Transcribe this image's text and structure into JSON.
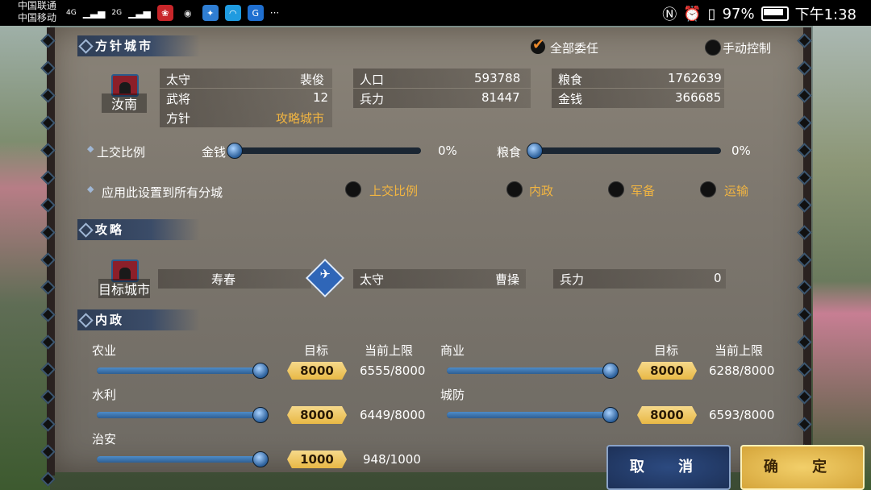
{
  "status_bar": {
    "carrier1": "中国联通",
    "carrier2": "中国移动",
    "signal1": "4G",
    "signal2": "2G",
    "battery": "97%",
    "time": "下午1:38"
  },
  "city_policy": {
    "header": "方针城市",
    "delegate_all": "全部委任",
    "manual_control": "手动控制",
    "city_name": "汝南",
    "stats": {
      "governor_label": "太守",
      "governor_value": "裴俊",
      "generals_label": "武将",
      "generals_value": "12",
      "policy_label": "方针",
      "policy_value": "攻略城市",
      "population_label": "人口",
      "population_value": "593788",
      "troops_label": "兵力",
      "troops_value": "81447",
      "food_label": "粮食",
      "food_value": "1762639",
      "gold_label": "金钱",
      "gold_value": "366685"
    },
    "tribute": {
      "label": "上交比例",
      "gold_label": "金钱",
      "gold_percent": "0%",
      "gold_level": 0,
      "food_label": "粮食",
      "food_percent": "0%",
      "food_level": 0
    },
    "apply_all": {
      "label": "应用此设置到所有分城",
      "options": [
        "上交比例",
        "内政",
        "军备",
        "运输"
      ]
    }
  },
  "attack": {
    "header": "攻略",
    "target_label": "目标城市",
    "target_city": "寿春",
    "governor_label": "太守",
    "governor_value": "曹操",
    "troops_label": "兵力",
    "troops_value": "0"
  },
  "domestic": {
    "header": "内政",
    "target_col": "目标",
    "limit_col": "当前上限",
    "items": [
      {
        "name": "农业",
        "target": "8000",
        "limit": "6555/8000",
        "level": 1.0
      },
      {
        "name": "商业",
        "target": "8000",
        "limit": "6288/8000",
        "level": 1.0
      },
      {
        "name": "水利",
        "target": "8000",
        "limit": "6449/8000",
        "level": 1.0
      },
      {
        "name": "城防",
        "target": "8000",
        "limit": "6593/8000",
        "level": 1.0
      },
      {
        "name": "治安",
        "target": "1000",
        "limit": "948/1000",
        "level": 1.0
      }
    ]
  },
  "buttons": {
    "cancel": "取 消",
    "confirm": "确 定"
  },
  "colors": {
    "accent_gold": "#f2b541",
    "header_blue": "#2e3d55",
    "slider_blue": "#2f5f93"
  }
}
